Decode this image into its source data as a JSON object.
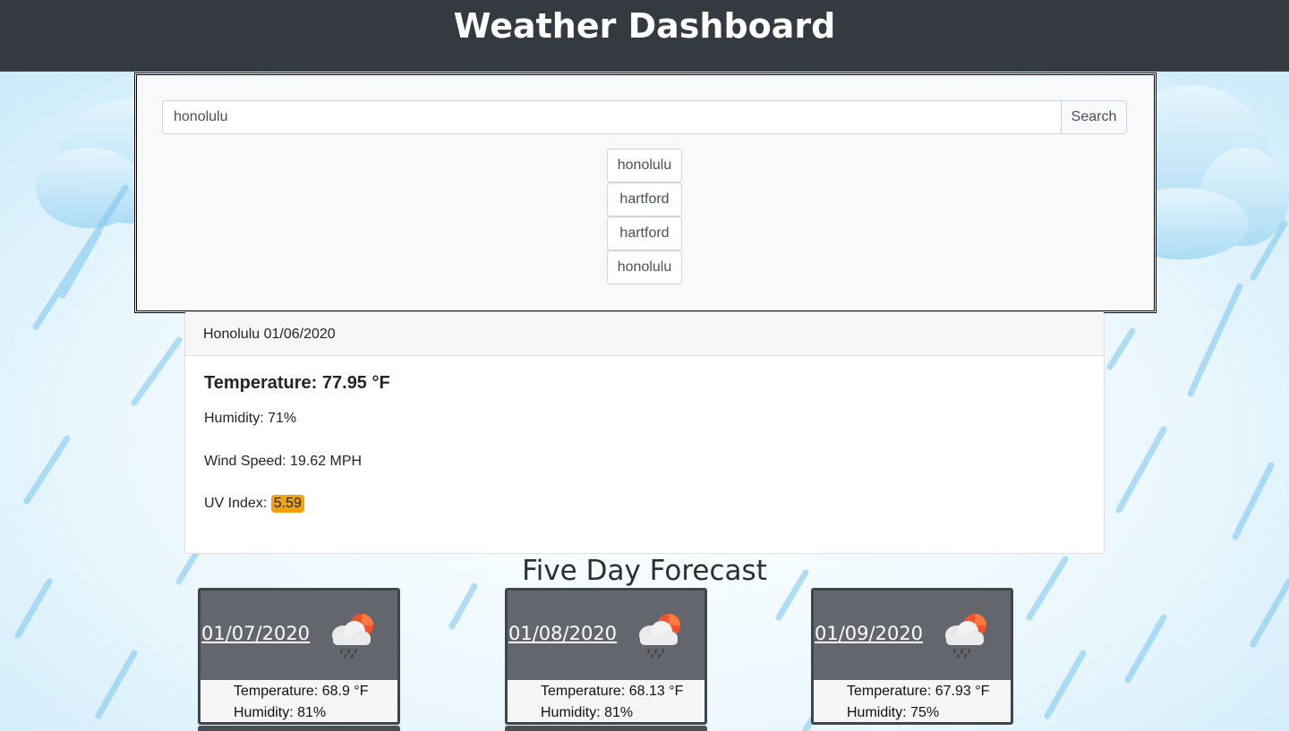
{
  "header": {
    "title": "Weather Dashboard"
  },
  "search": {
    "value": "honolulu",
    "button_label": "Search",
    "history": [
      "honolulu",
      "hartford",
      "hartford",
      "honolulu"
    ]
  },
  "current": {
    "header": "Honolulu 01/06/2020",
    "temperature": "Temperature: 77.95 °F",
    "humidity": "Humidity: 71%",
    "wind": "Wind Speed: 19.62 MPH",
    "uv_label": "UV Index: ",
    "uv_value": "5.59",
    "uv_color": "#f2a20d"
  },
  "forecast": {
    "title": "Five Day Forecast",
    "days": [
      {
        "date": "01/07/2020",
        "icon": "rain-sun-cloud-icon",
        "temperature": "Temperature: 68.9 °F",
        "humidity": "Humidity: 81%"
      },
      {
        "date": "01/08/2020",
        "icon": "rain-sun-cloud-icon",
        "temperature": "Temperature: 68.13 °F",
        "humidity": "Humidity: 81%"
      },
      {
        "date": "01/09/2020",
        "icon": "rain-sun-cloud-icon",
        "temperature": "Temperature: 67.93 °F",
        "humidity": "Humidity: 75%"
      }
    ]
  },
  "colors": {
    "header_bg": "#343a40",
    "card_bg": "#63676d"
  }
}
